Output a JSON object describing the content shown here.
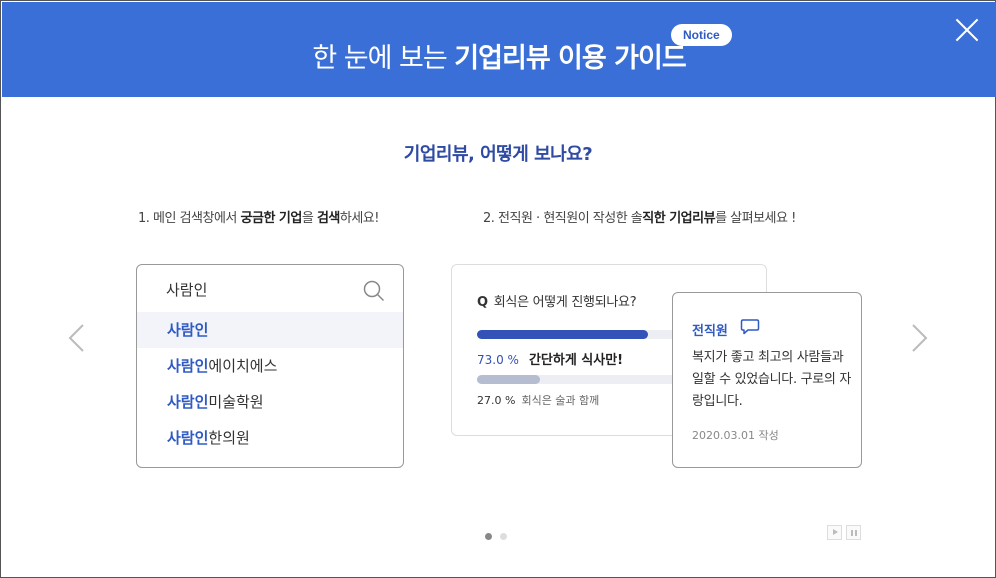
{
  "header": {
    "title_light": "한 눈에 보는",
    "title_bold": "기업리뷰 이용 가이드",
    "notice_badge": "Notice"
  },
  "main": {
    "section_title": "기업리뷰, 어떻게 보나요?",
    "step1": {
      "prefix": "1. 메인 검색창에서 ",
      "bold1": "궁금한 기업",
      "mid": "을 ",
      "bold2": "검색",
      "suffix": "하세요!"
    },
    "step2": {
      "prefix": "2. 전직원 · 현직원이 작성한 솔",
      "bold1": "직한 기업리뷰",
      "suffix": "를 살펴보세요 !"
    }
  },
  "search": {
    "value": "사람인",
    "suggestions": [
      {
        "highlight": "사람인",
        "rest": ""
      },
      {
        "highlight": "사람인",
        "rest": "에이치에스"
      },
      {
        "highlight": "사람인",
        "rest": "미술학원"
      },
      {
        "highlight": "사람인",
        "rest": "한의원"
      }
    ]
  },
  "poll": {
    "q_marker": "Q",
    "question": "회식은 어떻게 진행되나요?",
    "answers": [
      {
        "pct": "73.0 %",
        "label": "간단하게 식사만!",
        "value": 0.73
      },
      {
        "pct": "27.0 %",
        "label": "회식은 술과 함께",
        "value": 0.27
      }
    ]
  },
  "review": {
    "author": "전직원",
    "text": "복지가 좋고 최고의 사람들과 일할 수 있었습니다. 구로의 자랑입니다.",
    "date": "2020.03.01 작성"
  },
  "colors": {
    "header_bg": "#3a6fd8",
    "accent": "#2f5ac4",
    "bar_primary": "#3352b8",
    "bar_secondary": "#b7bdd0"
  }
}
